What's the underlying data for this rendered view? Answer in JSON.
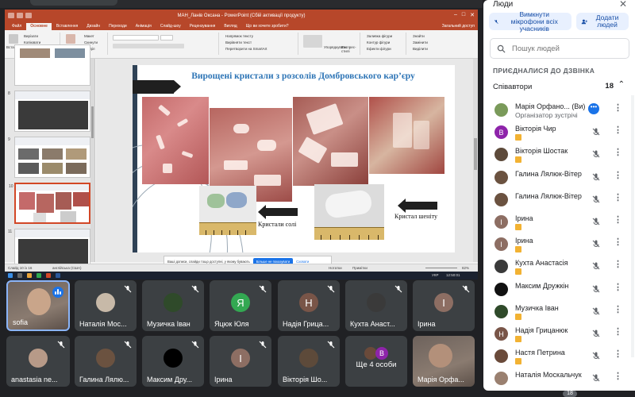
{
  "ppt": {
    "window_title": "МАН_Ланів Оксана - PowerPoint (Сбій активації продукту)",
    "tabs": [
      "Файл",
      "Основне",
      "Вставлення",
      "Дизайн",
      "Переходи",
      "Анімація",
      "Слайд-шоу",
      "Рецензування",
      "Вигляд",
      "Що ви хочете зробити?"
    ],
    "share_label": "Загальний доступ",
    "ribbon": {
      "paste": "Вставити",
      "cut": "Вирізати",
      "copy": "Копіювати",
      "format_painter": "Формат за зразком",
      "new_slide": "Створити слайд",
      "layout": "Макет",
      "reset": "Скинути",
      "section": "Розділ",
      "text_direction": "Напрямок тексту",
      "align_text": "Вирівняти текст",
      "smartart": "Перетворити на SmartArt",
      "arrange": "Упорядкувати",
      "quick_styles": "Експрес-стилі",
      "shape_fill": "Заливка фігури",
      "shape_outline": "Контур фігури",
      "shape_effects": "Ефекти фігури",
      "find": "Знайти",
      "replace": "Замінити",
      "select": "Виділити"
    },
    "thumb_numbers": [
      "8",
      "9",
      "10",
      "11"
    ],
    "slide": {
      "title": "Вирощені кристали з розсолів Домбровського кар’єру",
      "caption_salt": "Кристали солі",
      "caption_gypsum": "Кристал шеніту"
    },
    "notification": {
      "text": "Ваші дописи, слайди тощо доступні, у якому бувають",
      "button": "Більше не показувати",
      "hide": "Сховати"
    },
    "status": {
      "slide_of": "Слайд 10 із 16",
      "language": "англійська (США)",
      "notes": "Нотатки",
      "comments": "Примітки",
      "zoom": "82%"
    },
    "taskbar": {
      "time": "12:50:01",
      "lang": "УКР"
    }
  },
  "tiles": [
    {
      "name": "sofia",
      "type": "video-self",
      "speaking": true
    },
    {
      "name": "Наталія Мос...",
      "type": "photo",
      "muted": true
    },
    {
      "name": "Музичка Іван",
      "type": "photo",
      "muted": true
    },
    {
      "name": "Яцюк Юля",
      "type": "letter",
      "letter": "Я",
      "color": "#33a852",
      "muted": true
    },
    {
      "name": "Надія Грица...",
      "type": "letter",
      "letter": "Н",
      "color": "#795548",
      "muted": true
    },
    {
      "name": "Кухта Анаст...",
      "type": "photo",
      "muted": true
    },
    {
      "name": "Ірина",
      "type": "letter",
      "letter": "І",
      "color": "#8d6e63",
      "muted": true
    },
    {
      "name": "anastasia ne...",
      "type": "photo",
      "muted": true
    },
    {
      "name": "Галина Лялю...",
      "type": "photo",
      "muted": true
    },
    {
      "name": "Максим Дру...",
      "type": "black",
      "muted": true
    },
    {
      "name": "Ірина",
      "type": "letter",
      "letter": "І",
      "color": "#8d6e63",
      "muted": true
    },
    {
      "name": "Вікторія Шо...",
      "type": "photo",
      "muted": true
    },
    {
      "name": "Ще 4 особи",
      "type": "more",
      "muted": false
    },
    {
      "name": "Марія Орфа...",
      "type": "video",
      "muted": false
    }
  ],
  "panel": {
    "title": "Люди",
    "mute_all": "Вимкнути мікрофони всіх учасників",
    "add_people": "Додати людей",
    "search_placeholder": "Пошук людей",
    "section": "ПРИЄДНАЛИСЯ ДО ДЗВІНКА",
    "group_name": "Співавтори",
    "group_count": "18",
    "people": [
      {
        "name": "Марія Орфано... (Ви)",
        "role": "Організатор зустрічі",
        "avatar": "photo",
        "color": "#7a9a5a",
        "host": true
      },
      {
        "name": "Вікторія Чир",
        "avatar": "letter",
        "letter": "В",
        "color": "#8e24aa",
        "hand": true
      },
      {
        "name": "Вікторія Шостак",
        "avatar": "photo",
        "color": "#5d4a3a",
        "hand": true
      },
      {
        "name": "Галина Лялюк-Вітер",
        "avatar": "photo",
        "color": "#6b5240",
        "hand": false
      },
      {
        "name": "Галина Лялюк-Вітер",
        "avatar": "photo",
        "color": "#6b5240",
        "hand": false
      },
      {
        "name": "Ірина",
        "avatar": "letter",
        "letter": "І",
        "color": "#8d6e63",
        "hand": true
      },
      {
        "name": "Ірина",
        "avatar": "letter",
        "letter": "І",
        "color": "#8d6e63",
        "hand": true
      },
      {
        "name": "Кухта Анастасія",
        "avatar": "photo",
        "color": "#3a3a3a",
        "hand": true
      },
      {
        "name": "Максим Дружкін",
        "avatar": "photo",
        "color": "#111111",
        "hand": false
      },
      {
        "name": "Музичка Іван",
        "avatar": "photo",
        "color": "#2f4a2a",
        "hand": true
      },
      {
        "name": "Надія Грицанюк",
        "avatar": "letter",
        "letter": "Н",
        "color": "#795548",
        "hand": true
      },
      {
        "name": "Настя Петрина",
        "avatar": "photo",
        "color": "#6a4a3a",
        "hand": true
      },
      {
        "name": "Наталія Москальчук",
        "avatar": "photo",
        "color": "#9a8070",
        "hand": false
      }
    ]
  },
  "bottom": {
    "participants_badge": "18"
  }
}
